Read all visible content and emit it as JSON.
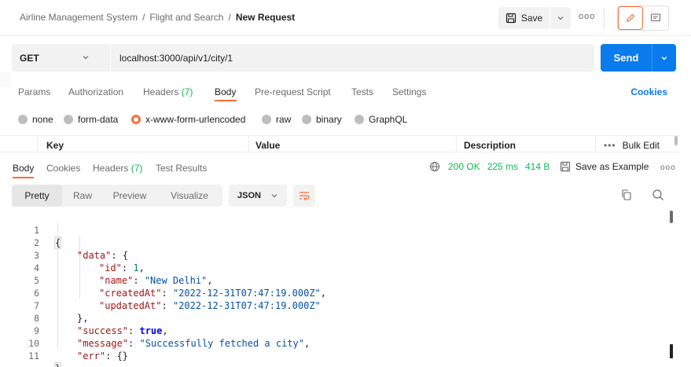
{
  "breadcrumb": {
    "workspace": "Airline Management System",
    "collection": "Flight and Search",
    "current": "New Request",
    "separator": "/"
  },
  "header": {
    "save_label": "Save",
    "more": "ooo"
  },
  "request": {
    "method": "GET",
    "url": "localhost:3000/api/v1/city/1",
    "send_label": "Send"
  },
  "request_tabs": {
    "params": "Params",
    "authorization": "Authorization",
    "headers": "Headers",
    "headers_count": "(7)",
    "body": "Body",
    "prerequest": "Pre-request Script",
    "tests": "Tests",
    "settings": "Settings",
    "cookies": "Cookies"
  },
  "body_types": {
    "none": "none",
    "form_data": "form-data",
    "urlencoded": "x-www-form-urlencoded",
    "raw": "raw",
    "binary": "binary",
    "graphql": "GraphQL",
    "selected": "x-www-form-urlencoded"
  },
  "kv_table": {
    "key": "Key",
    "value": "Value",
    "description": "Description",
    "bulk_dots": "•••",
    "bulk_edit": "Bulk Edit"
  },
  "response_tabs": {
    "body": "Body",
    "cookies": "Cookies",
    "headers": "Headers",
    "headers_count": "(7)",
    "test_results": "Test Results"
  },
  "response_status": {
    "status": "200 OK",
    "time": "225 ms",
    "size": "414 B",
    "save_example": "Save as Example",
    "more": "ooo"
  },
  "format": {
    "pretty": "Pretty",
    "raw": "Raw",
    "preview": "Preview",
    "visualize": "Visualize",
    "language": "JSON"
  },
  "code": {
    "line_numbers": [
      "1",
      "2",
      "3",
      "4",
      "5",
      "6",
      "7",
      "8",
      "9",
      "10",
      "11"
    ],
    "open_brace": "{",
    "close_brace": "}",
    "data_key": "\"data\"",
    "data_open": "{",
    "id_key": "\"id\"",
    "id_val": "1",
    "name_key": "\"name\"",
    "name_val": "\"New Delhi\"",
    "created_key": "\"createdAt\"",
    "created_val": "\"2022-12-31T07:47:19.000Z\"",
    "updated_key": "\"updatedAt\"",
    "updated_val": "\"2022-12-31T07:47:19.000Z\"",
    "data_close": "},",
    "success_key": "\"success\"",
    "success_val": "true",
    "message_key": "\"message\"",
    "message_val": "\"Successfully fetched a city\"",
    "err_key": "\"err\"",
    "err_val": "{}"
  },
  "colors": {
    "accent": "#ff6c37",
    "send_blue": "#097bed",
    "status_green": "#0cbb52"
  }
}
